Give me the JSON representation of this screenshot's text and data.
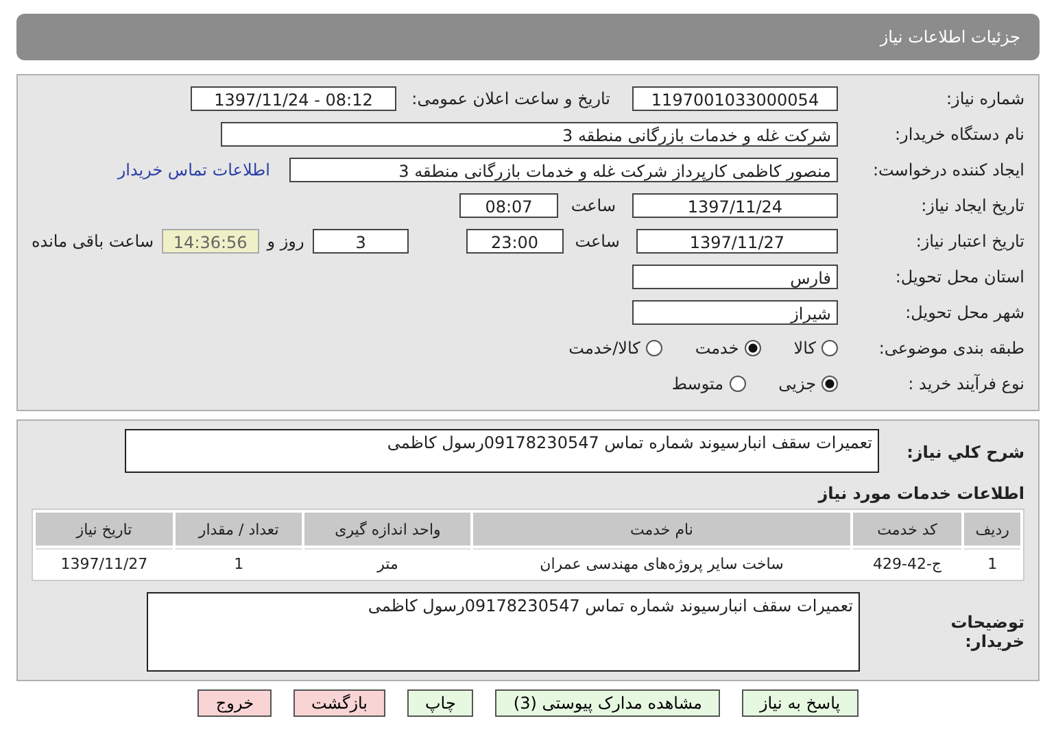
{
  "header": {
    "title": "جزئیات اطلاعات نیاز"
  },
  "need_number": {
    "label": "شماره نیاز:",
    "value": "1197001033000054"
  },
  "announce": {
    "label": "تاریخ و ساعت اعلان عمومی:",
    "value": "1397/11/24 - 08:12"
  },
  "buyer": {
    "label": "نام دستگاه خریدار:",
    "value": "شرکت غله و خدمات بازرگانی منطقه 3"
  },
  "creator": {
    "label": "ایجاد کننده درخواست:",
    "value": "منصور کاظمی کارپرداز شرکت غله و خدمات بازرگانی منطقه 3",
    "link": "اطلاعات تماس خریدار"
  },
  "created": {
    "label": "تاریخ ایجاد نیاز:",
    "date": "1397/11/24",
    "time_label": "ساعت",
    "time": "08:07"
  },
  "validity": {
    "label": "تاریخ اعتبار نیاز:",
    "date": "1397/11/27",
    "time_label": "ساعت",
    "time": "23:00",
    "days": "3",
    "days_label": "روز و",
    "remaining": "14:36:56",
    "remaining_label": "ساعت باقی مانده"
  },
  "province": {
    "label": "استان محل تحویل:",
    "value": "فارس"
  },
  "city": {
    "label": "شهر محل تحویل:",
    "value": "شیراز"
  },
  "category": {
    "label": "طبقه بندی موضوعی:",
    "options": [
      {
        "label": "کالا",
        "selected": false
      },
      {
        "label": "خدمت",
        "selected": true
      },
      {
        "label": "کالا/خدمت",
        "selected": false
      }
    ]
  },
  "process": {
    "label": "نوع فرآیند خرید :",
    "options": [
      {
        "label": "جزیی",
        "selected": true
      },
      {
        "label": "متوسط",
        "selected": false
      }
    ]
  },
  "description": {
    "label": "شرح کلي نیاز:",
    "value": "تعمیرات سقف انبارسیوند شماره تماس 09178230547رسول کاظمی"
  },
  "services": {
    "title": "اطلاعات خدمات مورد نیاز",
    "columns": [
      "ردیف",
      "کد خدمت",
      "نام خدمت",
      "واحد اندازه گیری",
      "تعداد / مقدار",
      "تاریخ نیاز"
    ],
    "rows": [
      [
        "1",
        "ج-42-429",
        "ساخت سایر پروژه‌های مهندسی عمران",
        "متر",
        "1",
        "1397/11/27"
      ]
    ]
  },
  "notes": {
    "label": "توضیحات خریدار:",
    "value": "تعمیرات سقف انبارسیوند شماره تماس 09178230547رسول کاظمی"
  },
  "buttons": [
    {
      "label": "پاسخ به نیاز",
      "kind": "primary"
    },
    {
      "label": "مشاهده مدارک پیوستی (3)",
      "kind": "primary"
    },
    {
      "label": "چاپ",
      "kind": "primary"
    },
    {
      "label": "بازگشت",
      "kind": "danger"
    },
    {
      "label": "خروج",
      "kind": "danger"
    }
  ]
}
